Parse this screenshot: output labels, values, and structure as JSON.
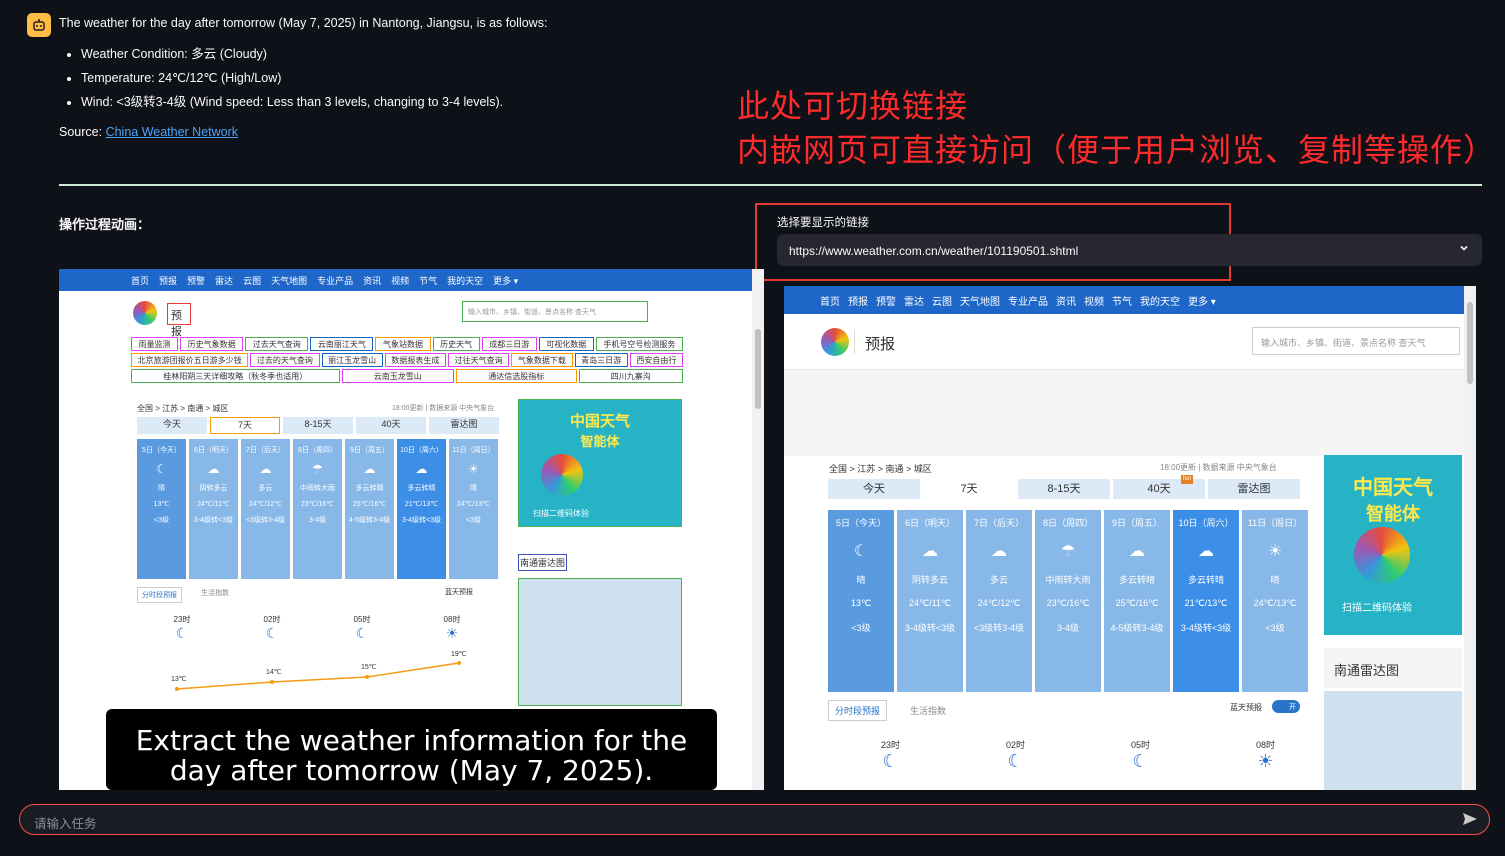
{
  "chat": {
    "intro": "The weather for the day after tomorrow (May 7, 2025) in Nantong, Jiangsu, is as follows:",
    "items": [
      "Weather Condition: 多云 (Cloudy)",
      "Temperature: 24℃/12℃ (High/Low)",
      "Wind: <3级转3-4级 (Wind speed: Less than 3 levels, changing to 3-4 levels)."
    ],
    "source_label": "Source: ",
    "source_link": "China Weather Network"
  },
  "annotation": {
    "line1": "此处可切换链接",
    "line2": "内嵌网页可直接访问（便于用户浏览、复制等操作）"
  },
  "left_panel": {
    "label": "操作过程动画：",
    "caption": "Extract the weather information for the day after tomorrow (May 7, 2025)."
  },
  "right_panel": {
    "select_label": "选择要显示的链接",
    "selected_url": "https://www.weather.com.cn/weather/101190501.shtml"
  },
  "chat_input": {
    "placeholder": "请输入任务"
  },
  "site": {
    "nav": [
      "首页",
      "预报",
      "预警",
      "雷达",
      "云图",
      "天气地图",
      "专业产品",
      "资讯",
      "视频",
      "节气",
      "我的天空",
      "更多 ▾"
    ],
    "nav_left_short": [
      "首页",
      "预报",
      "预警",
      "雷达",
      "云图",
      "天气地图",
      "专业产品",
      "资讯",
      "视频",
      "节气",
      "我的天空",
      "更多 ▾"
    ],
    "brand": "预报",
    "search_placeholder": "输入城市、乡镇、街道、景点名称 查天气",
    "links": [
      "雨量监测",
      "历史气象数据",
      "过去天气查询",
      "云南丽江天气",
      "气象站数据",
      "历史天气",
      "成都三日游",
      "可视化数据",
      "手机号空号检测服务",
      "北京旅游团报价五日游多少钱",
      "过去的天气查询",
      "丽江玉龙雪山",
      "数据报表生成",
      "过往天气查询",
      "气象数据下载",
      "青岛三日游",
      "西安自由行",
      "桂林阳朔三天详细攻略（秋冬季也适用）",
      "云南玉龙雪山",
      "通达信选股指标",
      "四川九寨沟"
    ],
    "crumb": "全国 > 江苏 > 南通 > 城区",
    "updated": "18:00更新 | 数据来源 中央气象台",
    "tabs": [
      "今天",
      "7天",
      "8-15天",
      "40天",
      "雷达图"
    ],
    "hot": "hot",
    "days": [
      {
        "name": "5日（今天）",
        "icon1": "☾",
        "icon2": "",
        "cond": "晴",
        "temp": "13℃",
        "wind": "<3级"
      },
      {
        "name": "6日（明天）",
        "icon1": "☁",
        "icon2": "☁",
        "cond": "阴转多云",
        "temp": "24℃/11℃",
        "wind": "3-4级转<3级"
      },
      {
        "name": "7日（后天）",
        "icon1": "☁",
        "icon2": "☁",
        "cond": "多云",
        "temp": "24℃/12℃",
        "wind": "<3级转3-4级"
      },
      {
        "name": "8日（周四）",
        "icon1": "☂",
        "icon2": "☂",
        "cond": "中雨转大雨",
        "temp": "23℃/16℃",
        "wind": "3-4级"
      },
      {
        "name": "9日（周五）",
        "icon1": "☁",
        "icon2": "☾",
        "cond": "多云转晴",
        "temp": "25℃/16℃",
        "wind": "4-5级转3-4级"
      },
      {
        "name": "10日（周六）",
        "icon1": "☁",
        "icon2": "☾",
        "cond": "多云转晴",
        "temp": "21℃/13℃",
        "wind": "3-4级转<3级"
      },
      {
        "name": "11日（周日）",
        "icon1": "☀",
        "icon2": "☾",
        "cond": "晴",
        "temp": "24℃/13℃",
        "wind": "<3级"
      }
    ],
    "subtabs": [
      "分时段预报",
      "生活指数"
    ],
    "blue_sky": "蓝天预报",
    "toggle": "开",
    "hours": [
      "23时",
      "02时",
      "05时",
      "08时"
    ],
    "hour_temps": [
      "13℃",
      "14℃",
      "15℃",
      "19℃"
    ],
    "promo_title": "中国天气",
    "promo_sub": "智能体",
    "promo_scan": "扫描二维码体验",
    "radar_title": "南通雷达图"
  },
  "colors": {
    "accent_red": "#ff2b2b",
    "link_blue": "#4fa3f7",
    "site_nav": "#1e66c8"
  }
}
